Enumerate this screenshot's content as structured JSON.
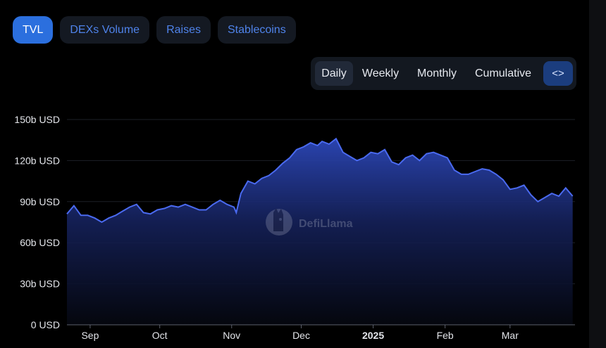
{
  "tabs": [
    {
      "label": "TVL",
      "active": true
    },
    {
      "label": "DEXs Volume",
      "active": false
    },
    {
      "label": "Raises",
      "active": false
    },
    {
      "label": "Stablecoins",
      "active": false
    }
  ],
  "granularity": {
    "options": [
      "Daily",
      "Weekly",
      "Monthly",
      "Cumulative"
    ],
    "selected": "Daily",
    "embed_icon": "<>"
  },
  "watermark": "DefiLlama",
  "colors": {
    "line": "#4a6af0",
    "active_tab": "#2b6fde",
    "tab_text": "#4f83ea"
  },
  "chart_data": {
    "type": "area",
    "ylim": [
      0,
      150
    ],
    "yticks": [
      0,
      30,
      60,
      90,
      120,
      150
    ],
    "ytick_labels": [
      "0 USD",
      "30b USD",
      "60b USD",
      "90b USD",
      "120b USD",
      "150b USD"
    ],
    "xtick_labels": [
      {
        "label": "Sep",
        "day": 10,
        "bold": false
      },
      {
        "label": "Oct",
        "day": 40,
        "bold": false
      },
      {
        "label": "Nov",
        "day": 71,
        "bold": false
      },
      {
        "label": "Dec",
        "day": 101,
        "bold": false
      },
      {
        "label": "2025",
        "day": 132,
        "bold": true
      },
      {
        "label": "Feb",
        "day": 163,
        "bold": false
      },
      {
        "label": "Mar",
        "day": 191,
        "bold": false
      }
    ],
    "x_range_days": [
      0,
      219
    ],
    "x": [
      0,
      3,
      6,
      9,
      12,
      15,
      18,
      21,
      24,
      27,
      30,
      33,
      36,
      39,
      42,
      45,
      48,
      51,
      54,
      57,
      60,
      63,
      66,
      69,
      72,
      73,
      75,
      78,
      81,
      84,
      87,
      90,
      93,
      96,
      99,
      102,
      105,
      108,
      110,
      113,
      116,
      119,
      122,
      125,
      128,
      131,
      134,
      137,
      140,
      143,
      146,
      149,
      152,
      155,
      158,
      161,
      164,
      167,
      170,
      173,
      176,
      179,
      182,
      185,
      188,
      191,
      194,
      197,
      200,
      203,
      206,
      209,
      212,
      215,
      218
    ],
    "values": [
      81,
      87,
      80,
      80,
      78,
      75,
      78,
      80,
      83,
      86,
      88,
      82,
      81,
      84,
      85,
      87,
      86,
      88,
      86,
      84,
      84,
      88,
      91,
      88,
      86,
      82,
      96,
      105,
      103,
      107,
      109,
      113,
      118,
      122,
      128,
      130,
      133,
      131,
      134,
      132,
      136,
      126,
      123,
      120,
      122,
      126,
      125,
      128,
      119,
      117,
      122,
      124,
      120,
      125,
      126,
      124,
      122,
      113,
      110,
      110,
      112,
      114,
      113,
      110,
      106,
      99,
      100,
      102,
      95,
      90,
      93,
      96,
      94,
      100,
      94
    ],
    "series": [
      {
        "values_ref": "values"
      }
    ]
  }
}
